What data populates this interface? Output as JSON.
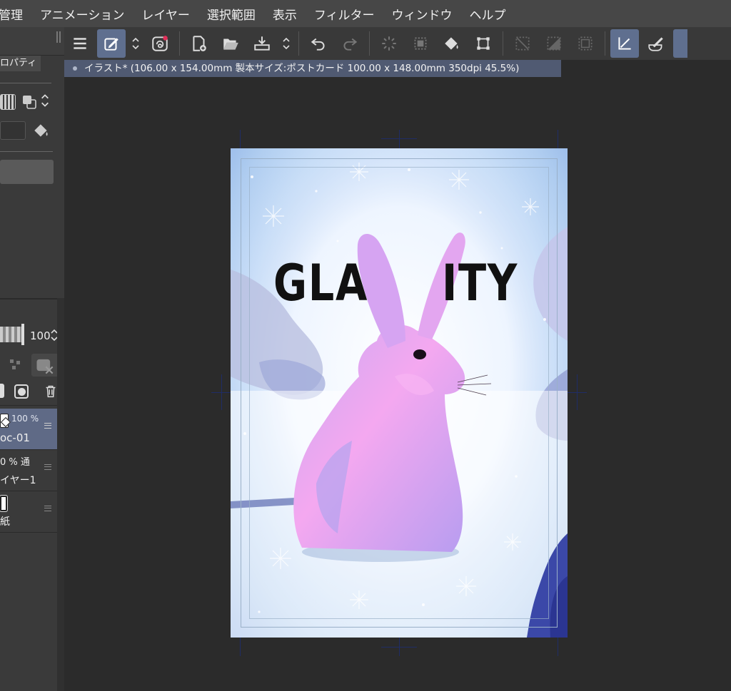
{
  "menu": [
    "管理",
    "アニメーション",
    "レイヤー",
    "選択範囲",
    "表示",
    "フィルター",
    "ウィンドウ",
    "ヘルプ"
  ],
  "status": {
    "text": "イラスト* (106.00 x 154.00mm 製本サイズ:ポストカード 100.00 x 148.00mm 350dpi 45.5%)"
  },
  "left_panel": {
    "tab_label": "ロパティ",
    "opacity_value": "100",
    "layers": [
      {
        "percent": "100 %",
        "name": "oc-01",
        "selected": true
      },
      {
        "percent": "0 % 通",
        "name": "イヤー1",
        "selected": false
      },
      {
        "percent": "",
        "name": "紙",
        "selected": false
      }
    ]
  },
  "artwork": {
    "title_left": "GLA",
    "title_right": "ITY"
  },
  "colors": {
    "menubar": "#474747",
    "toolbar": "#393939",
    "active_tool": "#5f6f8f",
    "status_bar": "#505a72",
    "canvas_bg": "#2b2b2b",
    "bunny_pink": "#f4a8f0",
    "bunny_lavender": "#b9a6ee"
  },
  "toolbar_icons": [
    "menu-icon",
    "edit-icon",
    "updown-icon",
    "layer-swirl-icon",
    "new-file-icon",
    "open-folder-icon",
    "save-icon",
    "updown-icon",
    "undo-icon",
    "redo-icon",
    "loading-icon",
    "selection-icon",
    "fill-icon",
    "transform-icon",
    "clear-outside-icon",
    "invert-icon",
    "frame-icon",
    "ruler-icon",
    "brush-icon"
  ]
}
